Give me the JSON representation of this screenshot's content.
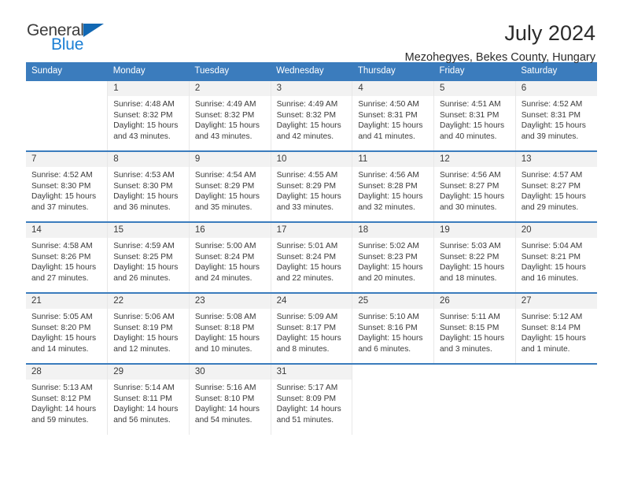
{
  "brand": {
    "name_part1": "General",
    "name_part2": "Blue",
    "triangle_color": "#1268b3",
    "text_color_1": "#3c3c3c",
    "text_color_2": "#1b7fd4",
    "logo_icon": "triangle-icon"
  },
  "header": {
    "title": "July 2024",
    "subtitle": "Mezohegyes, Bekes County, Hungary"
  },
  "theme": {
    "header_bg": "#3b7cbd",
    "header_text": "#ffffff",
    "daynum_bg": "#f2f2f2",
    "cell_border": "#e8e8e8",
    "row_top_border": "#3b7cbd",
    "body_text": "#3a3a3a"
  },
  "weekdays": [
    "Sunday",
    "Monday",
    "Tuesday",
    "Wednesday",
    "Thursday",
    "Friday",
    "Saturday"
  ],
  "labels": {
    "sunrise": "Sunrise:",
    "sunset": "Sunset:",
    "daylight": "Daylight:"
  },
  "weeks": [
    [
      {
        "day": "",
        "sunrise": "",
        "sunset": "",
        "daylight_line1": "",
        "daylight_line2": ""
      },
      {
        "day": "1",
        "sunrise": "Sunrise: 4:48 AM",
        "sunset": "Sunset: 8:32 PM",
        "daylight_line1": "Daylight: 15 hours",
        "daylight_line2": "and 43 minutes."
      },
      {
        "day": "2",
        "sunrise": "Sunrise: 4:49 AM",
        "sunset": "Sunset: 8:32 PM",
        "daylight_line1": "Daylight: 15 hours",
        "daylight_line2": "and 43 minutes."
      },
      {
        "day": "3",
        "sunrise": "Sunrise: 4:49 AM",
        "sunset": "Sunset: 8:32 PM",
        "daylight_line1": "Daylight: 15 hours",
        "daylight_line2": "and 42 minutes."
      },
      {
        "day": "4",
        "sunrise": "Sunrise: 4:50 AM",
        "sunset": "Sunset: 8:31 PM",
        "daylight_line1": "Daylight: 15 hours",
        "daylight_line2": "and 41 minutes."
      },
      {
        "day": "5",
        "sunrise": "Sunrise: 4:51 AM",
        "sunset": "Sunset: 8:31 PM",
        "daylight_line1": "Daylight: 15 hours",
        "daylight_line2": "and 40 minutes."
      },
      {
        "day": "6",
        "sunrise": "Sunrise: 4:52 AM",
        "sunset": "Sunset: 8:31 PM",
        "daylight_line1": "Daylight: 15 hours",
        "daylight_line2": "and 39 minutes."
      }
    ],
    [
      {
        "day": "7",
        "sunrise": "Sunrise: 4:52 AM",
        "sunset": "Sunset: 8:30 PM",
        "daylight_line1": "Daylight: 15 hours",
        "daylight_line2": "and 37 minutes."
      },
      {
        "day": "8",
        "sunrise": "Sunrise: 4:53 AM",
        "sunset": "Sunset: 8:30 PM",
        "daylight_line1": "Daylight: 15 hours",
        "daylight_line2": "and 36 minutes."
      },
      {
        "day": "9",
        "sunrise": "Sunrise: 4:54 AM",
        "sunset": "Sunset: 8:29 PM",
        "daylight_line1": "Daylight: 15 hours",
        "daylight_line2": "and 35 minutes."
      },
      {
        "day": "10",
        "sunrise": "Sunrise: 4:55 AM",
        "sunset": "Sunset: 8:29 PM",
        "daylight_line1": "Daylight: 15 hours",
        "daylight_line2": "and 33 minutes."
      },
      {
        "day": "11",
        "sunrise": "Sunrise: 4:56 AM",
        "sunset": "Sunset: 8:28 PM",
        "daylight_line1": "Daylight: 15 hours",
        "daylight_line2": "and 32 minutes."
      },
      {
        "day": "12",
        "sunrise": "Sunrise: 4:56 AM",
        "sunset": "Sunset: 8:27 PM",
        "daylight_line1": "Daylight: 15 hours",
        "daylight_line2": "and 30 minutes."
      },
      {
        "day": "13",
        "sunrise": "Sunrise: 4:57 AM",
        "sunset": "Sunset: 8:27 PM",
        "daylight_line1": "Daylight: 15 hours",
        "daylight_line2": "and 29 minutes."
      }
    ],
    [
      {
        "day": "14",
        "sunrise": "Sunrise: 4:58 AM",
        "sunset": "Sunset: 8:26 PM",
        "daylight_line1": "Daylight: 15 hours",
        "daylight_line2": "and 27 minutes."
      },
      {
        "day": "15",
        "sunrise": "Sunrise: 4:59 AM",
        "sunset": "Sunset: 8:25 PM",
        "daylight_line1": "Daylight: 15 hours",
        "daylight_line2": "and 26 minutes."
      },
      {
        "day": "16",
        "sunrise": "Sunrise: 5:00 AM",
        "sunset": "Sunset: 8:24 PM",
        "daylight_line1": "Daylight: 15 hours",
        "daylight_line2": "and 24 minutes."
      },
      {
        "day": "17",
        "sunrise": "Sunrise: 5:01 AM",
        "sunset": "Sunset: 8:24 PM",
        "daylight_line1": "Daylight: 15 hours",
        "daylight_line2": "and 22 minutes."
      },
      {
        "day": "18",
        "sunrise": "Sunrise: 5:02 AM",
        "sunset": "Sunset: 8:23 PM",
        "daylight_line1": "Daylight: 15 hours",
        "daylight_line2": "and 20 minutes."
      },
      {
        "day": "19",
        "sunrise": "Sunrise: 5:03 AM",
        "sunset": "Sunset: 8:22 PM",
        "daylight_line1": "Daylight: 15 hours",
        "daylight_line2": "and 18 minutes."
      },
      {
        "day": "20",
        "sunrise": "Sunrise: 5:04 AM",
        "sunset": "Sunset: 8:21 PM",
        "daylight_line1": "Daylight: 15 hours",
        "daylight_line2": "and 16 minutes."
      }
    ],
    [
      {
        "day": "21",
        "sunrise": "Sunrise: 5:05 AM",
        "sunset": "Sunset: 8:20 PM",
        "daylight_line1": "Daylight: 15 hours",
        "daylight_line2": "and 14 minutes."
      },
      {
        "day": "22",
        "sunrise": "Sunrise: 5:06 AM",
        "sunset": "Sunset: 8:19 PM",
        "daylight_line1": "Daylight: 15 hours",
        "daylight_line2": "and 12 minutes."
      },
      {
        "day": "23",
        "sunrise": "Sunrise: 5:08 AM",
        "sunset": "Sunset: 8:18 PM",
        "daylight_line1": "Daylight: 15 hours",
        "daylight_line2": "and 10 minutes."
      },
      {
        "day": "24",
        "sunrise": "Sunrise: 5:09 AM",
        "sunset": "Sunset: 8:17 PM",
        "daylight_line1": "Daylight: 15 hours",
        "daylight_line2": "and 8 minutes."
      },
      {
        "day": "25",
        "sunrise": "Sunrise: 5:10 AM",
        "sunset": "Sunset: 8:16 PM",
        "daylight_line1": "Daylight: 15 hours",
        "daylight_line2": "and 6 minutes."
      },
      {
        "day": "26",
        "sunrise": "Sunrise: 5:11 AM",
        "sunset": "Sunset: 8:15 PM",
        "daylight_line1": "Daylight: 15 hours",
        "daylight_line2": "and 3 minutes."
      },
      {
        "day": "27",
        "sunrise": "Sunrise: 5:12 AM",
        "sunset": "Sunset: 8:14 PM",
        "daylight_line1": "Daylight: 15 hours",
        "daylight_line2": "and 1 minute."
      }
    ],
    [
      {
        "day": "28",
        "sunrise": "Sunrise: 5:13 AM",
        "sunset": "Sunset: 8:12 PM",
        "daylight_line1": "Daylight: 14 hours",
        "daylight_line2": "and 59 minutes."
      },
      {
        "day": "29",
        "sunrise": "Sunrise: 5:14 AM",
        "sunset": "Sunset: 8:11 PM",
        "daylight_line1": "Daylight: 14 hours",
        "daylight_line2": "and 56 minutes."
      },
      {
        "day": "30",
        "sunrise": "Sunrise: 5:16 AM",
        "sunset": "Sunset: 8:10 PM",
        "daylight_line1": "Daylight: 14 hours",
        "daylight_line2": "and 54 minutes."
      },
      {
        "day": "31",
        "sunrise": "Sunrise: 5:17 AM",
        "sunset": "Sunset: 8:09 PM",
        "daylight_line1": "Daylight: 14 hours",
        "daylight_line2": "and 51 minutes."
      },
      {
        "day": "",
        "sunrise": "",
        "sunset": "",
        "daylight_line1": "",
        "daylight_line2": ""
      },
      {
        "day": "",
        "sunrise": "",
        "sunset": "",
        "daylight_line1": "",
        "daylight_line2": ""
      },
      {
        "day": "",
        "sunrise": "",
        "sunset": "",
        "daylight_line1": "",
        "daylight_line2": ""
      }
    ]
  ]
}
